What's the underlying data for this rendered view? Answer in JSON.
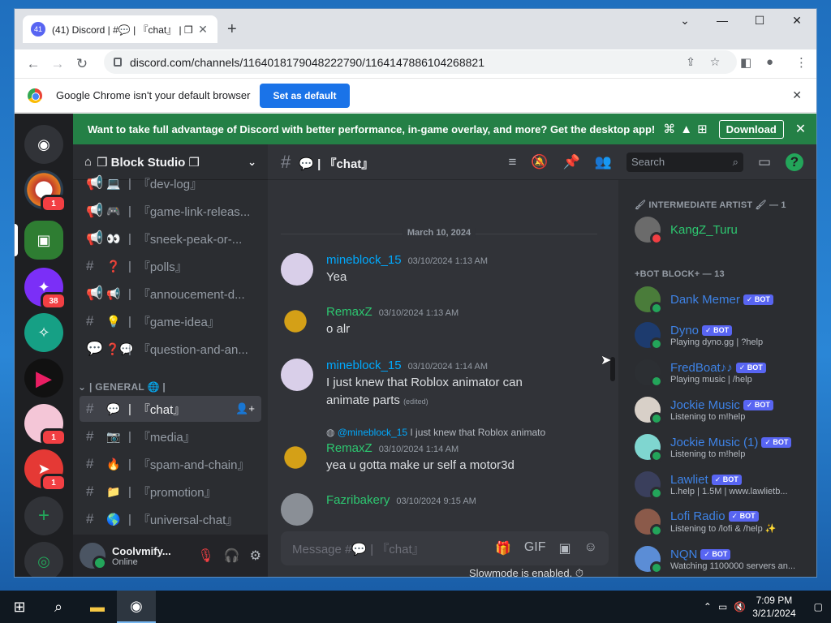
{
  "browser": {
    "tab_title": "(41) Discord | #💬 | 『chat』 | ❒ Bl...",
    "tab_badge": "41",
    "url": "discord.com/channels/1164018179048222790/1164147886104268821",
    "infobar_text": "Google Chrome isn't your default browser",
    "infobar_button": "Set as default"
  },
  "banner": {
    "text": "Want to take full advantage of Discord with better performance, in-game overlay, and more? Get the desktop app!",
    "download": "Download"
  },
  "servers": {
    "badges": [
      "1",
      "38",
      "1",
      "1",
      "1"
    ]
  },
  "guild": {
    "name": "❒ Block Studio ❒"
  },
  "channels": [
    {
      "emoji": "💻",
      "name": "『dev-log』"
    },
    {
      "emoji": "🎮",
      "name": "『game-link-releas..."
    },
    {
      "emoji": "👀",
      "name": "『sneek-peak-or-..."
    },
    {
      "emoji": "❓",
      "name": "『polls』"
    },
    {
      "emoji": "📢",
      "name": "『annoucement-d..."
    },
    {
      "emoji": "💡",
      "name": "『game-idea』"
    },
    {
      "emoji": "❓💬",
      "name": "『question-and-an..."
    }
  ],
  "category_general": "| GENERAL 🌐 |",
  "general_channels": [
    {
      "emoji": "💬",
      "name": "『chat』"
    },
    {
      "emoji": "📷",
      "name": "『media』"
    },
    {
      "emoji": "🔥",
      "name": "『spam-and-chain』"
    },
    {
      "emoji": "📁",
      "name": "『promotion』"
    },
    {
      "emoji": "🌎",
      "name": "『universal-chat』"
    }
  ],
  "user": {
    "name": "Coolvmify...",
    "status": "Online"
  },
  "chat": {
    "title": "💬 | 『chat』",
    "search_placeholder": "Search",
    "date_divider": "March 10, 2024",
    "messages": [
      {
        "author": "mineblock_15",
        "time": "03/10/2024 1:13 AM",
        "text": "Yea",
        "color": "#00a8fc"
      },
      {
        "author": "RemaxZ",
        "time": "03/10/2024 1:13 AM",
        "text": "o alr",
        "color": "#2dc770"
      },
      {
        "author": "mineblock_15",
        "time": "03/10/2024 1:14 AM",
        "text": "I just knew that Roblox animator can animate parts",
        "edited": "(edited)",
        "color": "#00a8fc"
      },
      {
        "author": "RemaxZ",
        "time": "03/10/2024 1:14 AM",
        "text": "yea u gotta make ur self a motor3d",
        "color": "#2dc770"
      },
      {
        "author": "Fazribakery",
        "time": "03/10/2024 9:15 AM",
        "text": "",
        "color": "#2dc770"
      }
    ],
    "reply_name": "@mineblock_15",
    "reply_text": "I just knew that Roblox animato",
    "composer_placeholder": "Message #💬 | 『chat』",
    "slowmode": "Slowmode is enabled."
  },
  "members": {
    "role1": "🖌 INTERMEDIATE ARTIST 🖌 — 1",
    "role2": "+BOT BLOCK+ — 13",
    "list1": [
      {
        "name": "KangZ_Turu",
        "color": "#2dc770"
      }
    ],
    "bots": [
      {
        "name": "Dank Memer",
        "activity": ""
      },
      {
        "name": "Dyno",
        "activity": "Playing dyno.gg | ?help"
      },
      {
        "name": "FredBoat♪♪",
        "activity": "Playing music | /help"
      },
      {
        "name": "Jockie Music",
        "activity": "Listening to m!help"
      },
      {
        "name": "Jockie Music (1)",
        "activity": "Listening to m!help"
      },
      {
        "name": "Lawliet",
        "activity": "L.help | 1.5M | www.lawlietb..."
      },
      {
        "name": "Lofi Radio",
        "activity": "Listening to /lofi & /help ✨"
      },
      {
        "name": "NQN",
        "activity": "Watching 1100000 servers an..."
      }
    ],
    "bot_label": "✓ BOT",
    "bot_color": "#3e82e5"
  },
  "taskbar": {
    "time": "7:09 PM",
    "date": "3/21/2024"
  }
}
